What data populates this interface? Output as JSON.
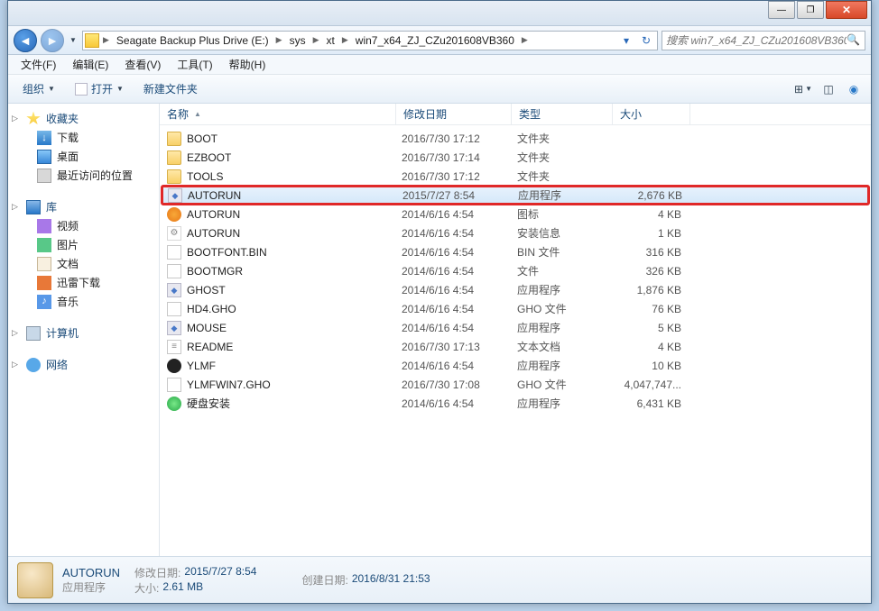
{
  "titlebar": {
    "min": "—",
    "max": "❐",
    "close": "✕"
  },
  "nav": {
    "crumbs": [
      "Seagate Backup Plus Drive (E:)",
      "sys",
      "xt",
      "win7_x64_ZJ_CZu201608VB360"
    ],
    "search_placeholder": "搜索 win7_x64_ZJ_CZu201608VB360"
  },
  "menu": [
    "文件(F)",
    "编辑(E)",
    "查看(V)",
    "工具(T)",
    "帮助(H)"
  ],
  "toolbar": {
    "org": "组织",
    "open": "打开",
    "newfolder": "新建文件夹"
  },
  "sidebar": {
    "fav": "收藏夹",
    "dl": "下载",
    "desk": "桌面",
    "recent": "最近访问的位置",
    "lib": "库",
    "vid": "视频",
    "pic": "图片",
    "doc": "文档",
    "thd": "迅雷下载",
    "mus": "音乐",
    "comp": "计算机",
    "net": "网络"
  },
  "columns": {
    "name": "名称",
    "date": "修改日期",
    "type": "类型",
    "size": "大小"
  },
  "files": [
    {
      "ico": "folder",
      "name": "BOOT",
      "date": "2016/7/30 17:12",
      "type": "文件夹",
      "size": ""
    },
    {
      "ico": "folder",
      "name": "EZBOOT",
      "date": "2016/7/30 17:14",
      "type": "文件夹",
      "size": ""
    },
    {
      "ico": "folder",
      "name": "TOOLS",
      "date": "2016/7/30 17:12",
      "type": "文件夹",
      "size": ""
    },
    {
      "ico": "exe",
      "name": "AUTORUN",
      "date": "2015/7/27 8:54",
      "type": "应用程序",
      "size": "2,676 KB",
      "sel": true,
      "hl": true
    },
    {
      "ico": "ico",
      "name": "AUTORUN",
      "date": "2014/6/16 4:54",
      "type": "图标",
      "size": "4 KB"
    },
    {
      "ico": "inf",
      "name": "AUTORUN",
      "date": "2014/6/16 4:54",
      "type": "安装信息",
      "size": "1 KB"
    },
    {
      "ico": "file",
      "name": "BOOTFONT.BIN",
      "date": "2014/6/16 4:54",
      "type": "BIN 文件",
      "size": "316 KB"
    },
    {
      "ico": "file",
      "name": "BOOTMGR",
      "date": "2014/6/16 4:54",
      "type": "文件",
      "size": "326 KB"
    },
    {
      "ico": "exe",
      "name": "GHOST",
      "date": "2014/6/16 4:54",
      "type": "应用程序",
      "size": "1,876 KB"
    },
    {
      "ico": "gho",
      "name": "HD4.GHO",
      "date": "2014/6/16 4:54",
      "type": "GHO 文件",
      "size": "76 KB"
    },
    {
      "ico": "exe",
      "name": "MOUSE",
      "date": "2014/6/16 4:54",
      "type": "应用程序",
      "size": "5 KB"
    },
    {
      "ico": "txt",
      "name": "README",
      "date": "2016/7/30 17:13",
      "type": "文本文档",
      "size": "4 KB"
    },
    {
      "ico": "ylmf",
      "name": "YLMF",
      "date": "2014/6/16 4:54",
      "type": "应用程序",
      "size": "10 KB"
    },
    {
      "ico": "gho",
      "name": "YLMFWIN7.GHO",
      "date": "2016/7/30 17:08",
      "type": "GHO 文件",
      "size": "4,047,747..."
    },
    {
      "ico": "inst",
      "name": "硬盘安装",
      "date": "2014/6/16 4:54",
      "type": "应用程序",
      "size": "6,431 KB"
    }
  ],
  "details": {
    "name": "AUTORUN",
    "type": "应用程序",
    "mod_lbl": "修改日期:",
    "mod_val": "2015/7/27 8:54",
    "size_lbl": "大小:",
    "size_val": "2.61 MB",
    "crt_lbl": "创建日期:",
    "crt_val": "2016/8/31 21:53"
  }
}
